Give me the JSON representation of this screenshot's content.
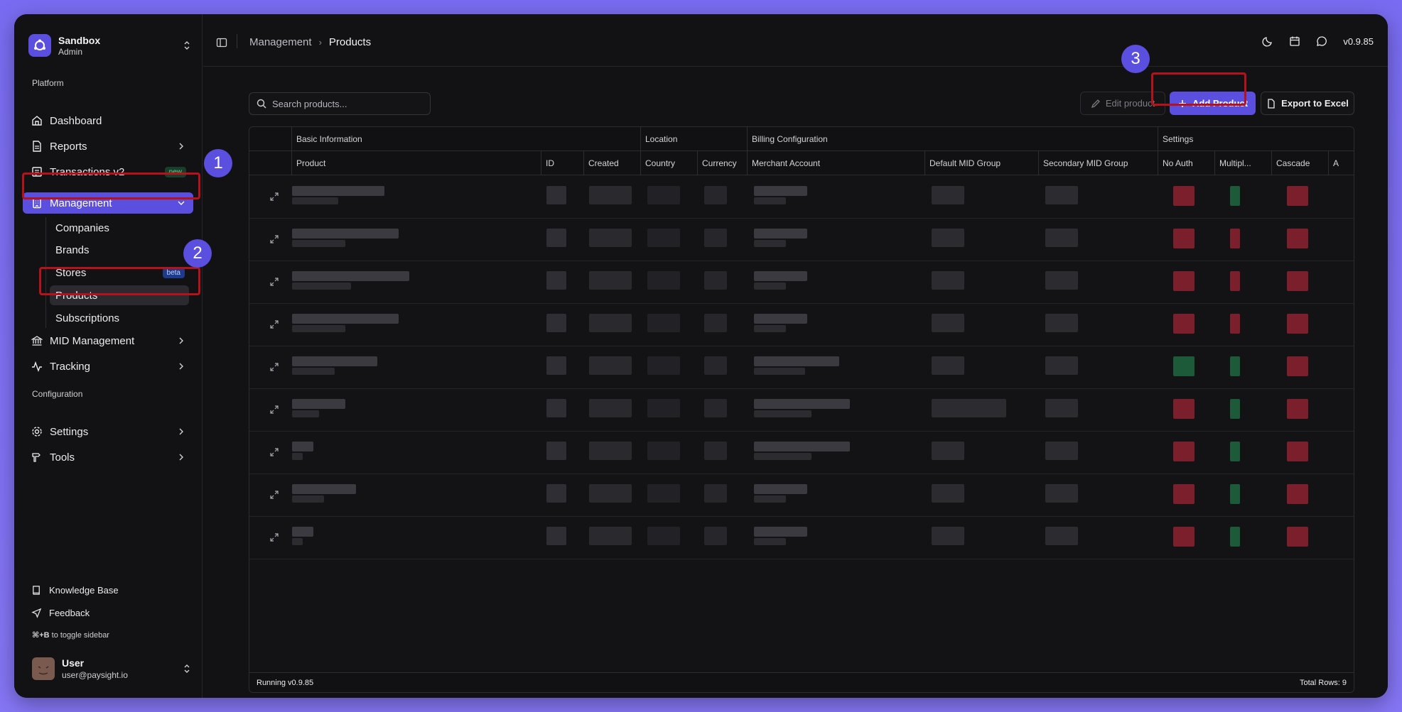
{
  "workspace": {
    "name": "Sandbox",
    "role": "Admin"
  },
  "sidebar": {
    "section_platform": "Platform",
    "section_config": "Configuration",
    "items": {
      "dashboard": "Dashboard",
      "reports": "Reports",
      "transactions": "Transactions v2",
      "transactions_badge": "new",
      "management": "Management",
      "mid_management": "MID Management",
      "tracking": "Tracking",
      "settings": "Settings",
      "tools": "Tools"
    },
    "management_sub": {
      "companies": "Companies",
      "brands": "Brands",
      "stores": "Stores",
      "stores_badge": "beta",
      "products": "Products",
      "subscriptions": "Subscriptions"
    },
    "knowledge_base": "Knowledge Base",
    "feedback": "Feedback",
    "shortcut_key": "⌘+B",
    "shortcut_text": " to toggle sidebar"
  },
  "user": {
    "name": "User",
    "email": "user@paysight.io"
  },
  "topbar": {
    "breadcrumb_parent": "Management",
    "breadcrumb_current": "Products",
    "version": "v0.9.85"
  },
  "toolbar": {
    "search_placeholder": "Search products...",
    "edit_label": "Edit product",
    "add_label": "Add Product",
    "export_label": "Export to Excel"
  },
  "table": {
    "groups": {
      "basic": "Basic Information",
      "location": "Location",
      "billing": "Billing Configuration",
      "settings": "Settings"
    },
    "columns": {
      "product": "Product",
      "id": "ID",
      "created": "Created",
      "country": "Country",
      "currency": "Currency",
      "merchant": "Merchant Account",
      "default_mid": "Default MID Group",
      "secondary_mid": "Secondary MID Group",
      "no_auth": "No Auth",
      "multiple": "Multipl...",
      "cascade": "Cascade",
      "extra": "A"
    },
    "row_count": 9,
    "footer_left": "Running v0.9.85",
    "footer_right": "Total Rows: 9"
  },
  "annotations": {
    "m1": "1",
    "m2": "2",
    "m3": "3"
  },
  "colors": {
    "accent": "#5b4fe0",
    "highlight": "#b5121b",
    "status_red": "#7a1f2b",
    "status_green": "#1c5a3a"
  }
}
